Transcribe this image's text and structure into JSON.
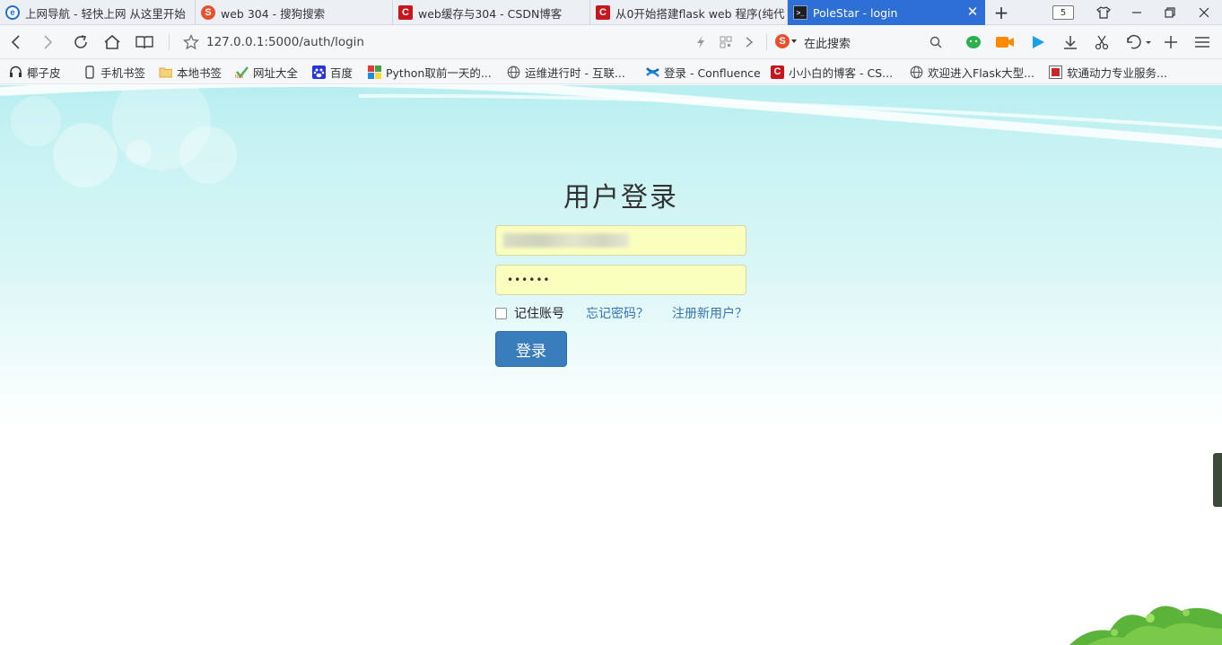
{
  "tabs": [
    {
      "title": "上网导航 - 轻快上网 从这里开始",
      "icon": "ie-icon"
    },
    {
      "title": "web 304 - 搜狗搜索",
      "icon": "sogou-icon"
    },
    {
      "title": "web缓存与304 - CSDN博客",
      "icon": "csdn-icon"
    },
    {
      "title": "从0开始搭建flask web 程序(纯代",
      "icon": "csdn-icon"
    },
    {
      "title": "PoleStar - login",
      "icon": "terminal-icon"
    }
  ],
  "tab_count": "5",
  "address": {
    "url": "127.0.0.1:5000/auth/login"
  },
  "search": {
    "placeholder": "在此搜索"
  },
  "bookmarks": [
    {
      "label": "椰子皮",
      "icon": "headphones-icon"
    },
    {
      "label": "手机书签",
      "icon": "phone-icon"
    },
    {
      "label": "本地书签",
      "icon": "folder-icon"
    },
    {
      "label": "网址大全",
      "icon": "hao-icon"
    },
    {
      "label": "百度",
      "icon": "baidu-paw-icon"
    },
    {
      "label": "Python取前一天的...",
      "icon": "python-icon"
    },
    {
      "label": "运维进行时 - 互联...",
      "icon": "globe-icon"
    },
    {
      "label": "登录 - Confluence",
      "icon": "confluence-icon"
    },
    {
      "label": "小小白的博客 - CS...",
      "icon": "csdn-icon"
    },
    {
      "label": "欢迎进入Flask大型...",
      "icon": "globe-icon"
    },
    {
      "label": "软通动力专业服务...",
      "icon": "isoftstone-icon"
    }
  ],
  "login": {
    "title": "用户登录",
    "password_mask": "••••••",
    "remember_label": "记住账号",
    "forgot_label": "忘记密码？",
    "register_label": "注册新用户？",
    "submit_label": "登录"
  },
  "colors": {
    "active_tab": "#2d6fd6",
    "input_bg": "#fbffbe",
    "button": "#3a7dbc",
    "link": "#3373b4"
  }
}
